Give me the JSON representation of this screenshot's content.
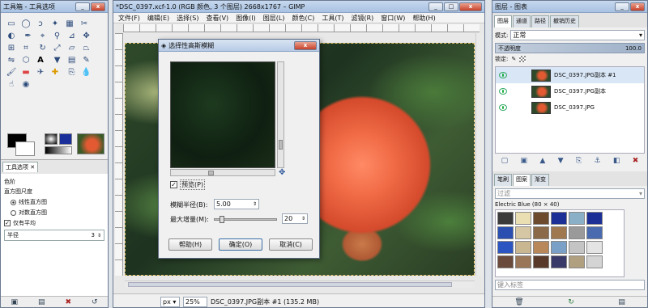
{
  "toolbox": {
    "title": "工具箱 - 工具选项",
    "tab_label": "工具选项",
    "section_label": "色阶",
    "mode_label": "直方图尺度",
    "radio1": "线性直方图",
    "radio2": "对数直方图",
    "checkbox_label": "仅有平均",
    "field_label": "半径",
    "field_value": "3"
  },
  "image_window": {
    "title": "*DSC_0397.xcf-1.0 (RGB 颜色, 3 个图层) 2668x1767 – GIMP",
    "menus": [
      "文件(F)",
      "编辑(E)",
      "选择(S)",
      "查看(V)",
      "图像(I)",
      "图层(L)",
      "颜色(C)",
      "工具(T)",
      "滤镜(R)",
      "窗口(W)",
      "帮助(H)"
    ],
    "unit": "px",
    "zoom": "25%",
    "status": "DSC_0397.JPG副本 #1 (135.2 MB)"
  },
  "dialog": {
    "title": "选择性高斯模糊",
    "preview_label": "预览(P)",
    "radius_label": "模糊半径(B):",
    "radius_value": "5.00",
    "maxdelta_label": "最大增量(M):",
    "maxdelta_value": "20",
    "help_label": "帮助(H)",
    "ok_label": "确定(O)",
    "cancel_label": "取消(C)",
    "close_label": "x"
  },
  "layers": {
    "title": "图层 - 图表",
    "tabs": [
      "图层",
      "通道",
      "路径",
      "撤销历史"
    ],
    "mode_label": "模式:",
    "mode_value": "正常",
    "opacity_label": "不透明度",
    "opacity_value": "100.0",
    "lock_label": "锁定:",
    "items": [
      "DSC_0397.JPG副本 #1",
      "DSC_0397.JPG副本",
      "DSC_0397.JPG"
    ]
  },
  "patterns": {
    "tabs": [
      "笔刷",
      "图案",
      "渐变"
    ],
    "filter_placeholder": "过滤",
    "pattern_name": "Electric Blue (80 × 40)",
    "tag_placeholder": "键入标签"
  },
  "colors": {
    "accent": "#3a6ea5",
    "titlebar": "#b9cde8",
    "canvas_bg": "#e8e8e8"
  }
}
